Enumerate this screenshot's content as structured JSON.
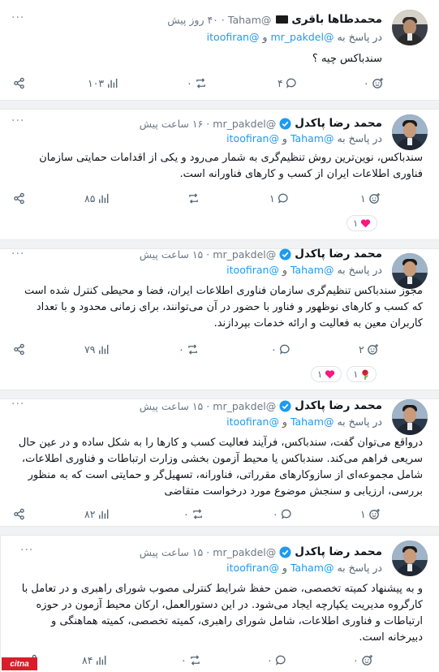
{
  "posts": [
    {
      "name": "محمدطاها باقری",
      "handle": "@Taham",
      "time": "۴۰ روز پیش",
      "reply_prefix": "در پاسخ به",
      "reply_to_1": "@mr_pakdel",
      "reply_and": "و",
      "reply_to_2": "@itoofiran",
      "body": "سندباکس چیه ؟",
      "views": "۱۰۳",
      "reposts": "۰",
      "comments": "۴",
      "likes": "۰"
    },
    {
      "name": "محمد رضا پاکدل",
      "handle": "@mr_pakdel",
      "time": "۱۶ ساعت پیش",
      "reply_prefix": "در پاسخ به",
      "reply_to_1": "@Taham",
      "reply_and": "و",
      "reply_to_2": "@itoofiran",
      "body": "سندباکس، نوین‌ترین روش تنظیم‌گری به شمار می‌رود و یکی از اقدامات حمایتی سازمان فناوری اطلاعات ایران از کسب و کارهای فناورانه است.",
      "views": "۸۵",
      "reposts": "",
      "comments": "۱",
      "likes": "۱",
      "reactions": [
        {
          "emoji": "heart",
          "count": "۱"
        }
      ]
    },
    {
      "name": "محمد رضا پاکدل",
      "handle": "@mr_pakdel",
      "time": "۱۵ ساعت پیش",
      "reply_prefix": "در پاسخ به",
      "reply_to_1": "@Taham",
      "reply_and": "و",
      "reply_to_2": "@itoofiran",
      "body": "مجوز سندباکس تنظیم‌گری سازمان فناوری اطلاعات ایران، فضا و محیطی کنترل شده است که کسب و کارهای نوظهور و فناور با حضور در آن می‌توانند، برای زمانی محدود و با تعداد کاربران معین به فعالیت و ارائه خدمات بپردازند.",
      "views": "۷۹",
      "reposts": "۰",
      "comments": "۰",
      "likes": "۲",
      "reactions": [
        {
          "emoji": "heart",
          "count": "۱"
        },
        {
          "emoji": "rose",
          "count": "۱"
        }
      ]
    },
    {
      "name": "محمد رضا پاکدل",
      "handle": "@mr_pakdel",
      "time": "۱۵ ساعت پیش",
      "reply_prefix": "در پاسخ به",
      "reply_to_1": "@Taham",
      "reply_and": "و",
      "reply_to_2": "@itoofiran",
      "body": "درواقع می‌توان گفت، سندباکس، فرآیند فعالیت کسب و کارها را به شکل ساده و در عین حال سریعی فراهم می‌کند. سندباکس یا محیط آزمون بخشی وزارت ارتباطات و فناوری اطلاعات، شامل مجموعه‌ای از سازوکارهای مقرراتی، فناورانه، تسهیل‌گر و حمایتی است که به منظور بررسی، ارزیابی و سنجش موضوع مورد درخواست متقاضی",
      "views": "۸۲",
      "reposts": "۰",
      "comments": "۰",
      "likes": "۱"
    },
    {
      "name": "محمد رضا پاکدل",
      "handle": "@mr_pakdel",
      "time": "۱۵ ساعت پیش",
      "reply_prefix": "در پاسخ به",
      "reply_to_1": "@Taham",
      "reply_and": "و",
      "reply_to_2": "@itoofiran",
      "body": "و به پیشنهاد کمیته تخصصی،  ضمن حفظ شرایط کنترلی مصوب شورای راهبری و در تعامل با کارگروه مدیریت یکپارچه ایجاد می‌شود. در این دستورالعمل، ارکان محیط آزمون در حوزه ارتباطات و فناوری اطلاعات، شامل شورای راهبری، کمیته تخصصی، کمیته هماهنگی و دبیرخانه است.",
      "views": "۸۴",
      "reposts": "۰",
      "comments": "۰",
      "likes": "۰"
    }
  ],
  "watermark": "citna",
  "colors": {
    "link": "#1d9bf0",
    "like": "#f91880",
    "verified": "#1d9bf0"
  }
}
